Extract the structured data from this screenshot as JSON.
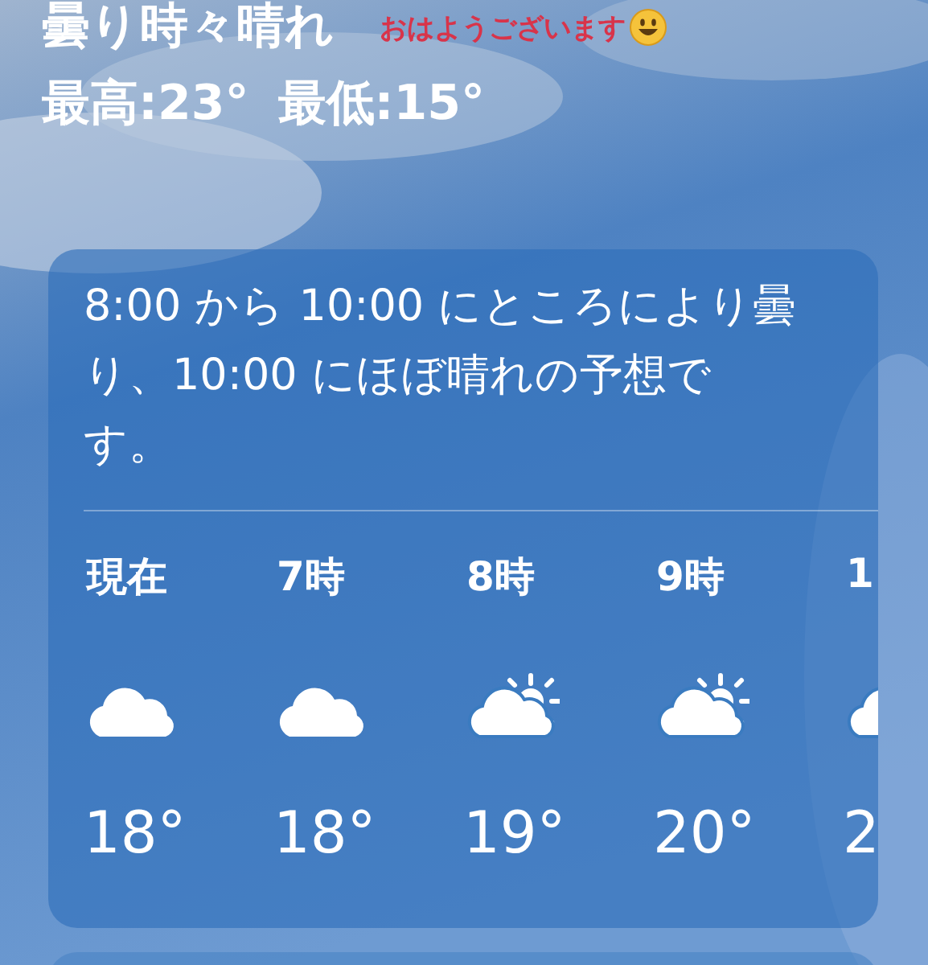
{
  "condition": "曇り時々晴れ",
  "greeting": "おはようございます",
  "high": "最高:23°",
  "low": "最低:15°",
  "forecast": {
    "summary": "8:00 から 10:00 にところにより曇り、10:00 にほぼ晴れの予想です。",
    "hours": [
      {
        "time": "現在",
        "kind": "cloudy",
        "temp": "18°"
      },
      {
        "time": "7時",
        "kind": "cloudy",
        "temp": "18°"
      },
      {
        "time": "8時",
        "kind": "partly_sunny",
        "temp": "19°"
      },
      {
        "time": "9時",
        "kind": "partly_sunny",
        "temp": "20°"
      },
      {
        "time": "1",
        "kind": "partly_sunny",
        "temp": "2"
      }
    ]
  }
}
